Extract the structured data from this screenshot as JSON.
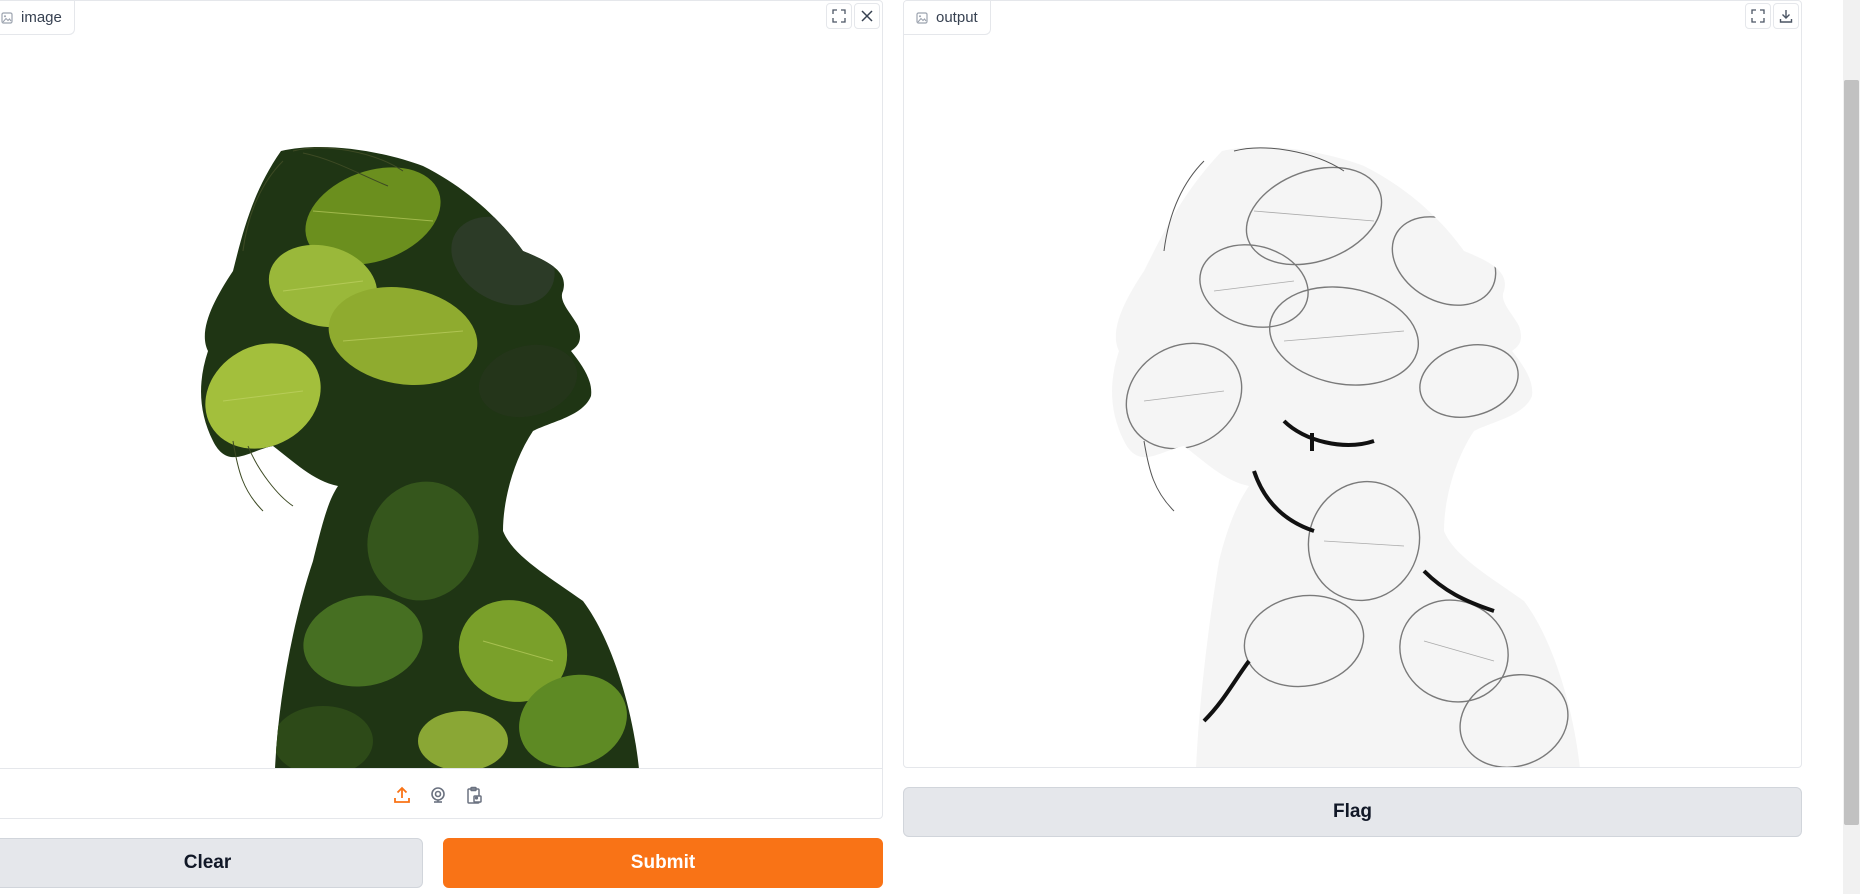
{
  "input_panel": {
    "label": "image",
    "label_icon": "image-icon",
    "corner_buttons": [
      "fullscreen-icon",
      "close-icon"
    ],
    "sources": [
      "upload-icon",
      "webcam-icon",
      "clipboard-icon"
    ],
    "image_description_hidden": ""
  },
  "output_panel": {
    "label": "output",
    "label_icon": "image-icon",
    "corner_buttons": [
      "fullscreen-icon",
      "download-icon"
    ]
  },
  "buttons": {
    "clear": "Clear",
    "submit": "Submit",
    "flag": "Flag"
  },
  "colors": {
    "primary": "#f97316",
    "secondary": "#e5e7eb",
    "border": "#e5e7eb"
  }
}
